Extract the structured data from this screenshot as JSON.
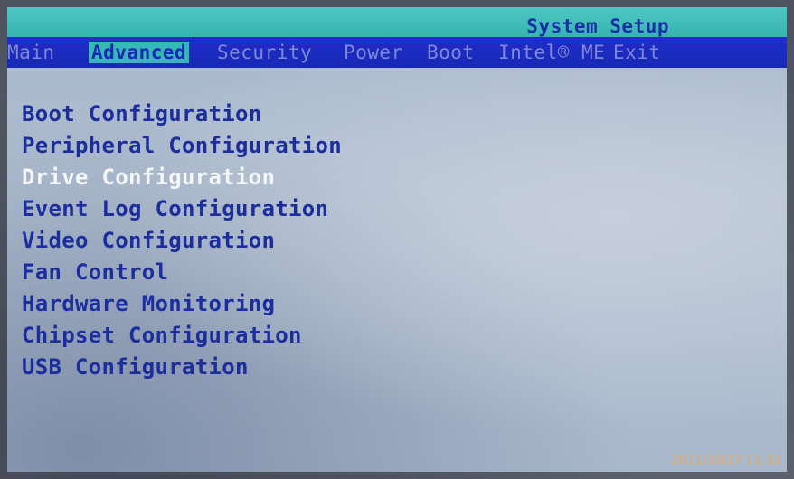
{
  "header": {
    "title": "System Setup"
  },
  "menu": {
    "items": [
      {
        "label": "Main"
      },
      {
        "label": "Advanced",
        "active": true
      },
      {
        "label": "Security"
      },
      {
        "label": "Power"
      },
      {
        "label": "Boot"
      },
      {
        "label": "Intel® ME"
      },
      {
        "label": "Exit"
      }
    ]
  },
  "advanced": {
    "options": [
      {
        "label": "Boot Configuration"
      },
      {
        "label": "Peripheral Configuration"
      },
      {
        "label": "Drive Configuration",
        "selected": true
      },
      {
        "label": "Event Log Configuration"
      },
      {
        "label": "Video Configuration"
      },
      {
        "label": "Fan Control"
      },
      {
        "label": "Hardware Monitoring"
      },
      {
        "label": "Chipset Configuration"
      },
      {
        "label": "USB Configuration"
      }
    ]
  },
  "photo": {
    "timestamp": "2011/10/27  11:32"
  },
  "colors": {
    "title_bar": "#36b4b2",
    "menu_bar": "#1829b6",
    "option_text": "#1c2d9e",
    "selected_text": "#f4f6fa",
    "timestamp_text": "#e8a85a"
  }
}
